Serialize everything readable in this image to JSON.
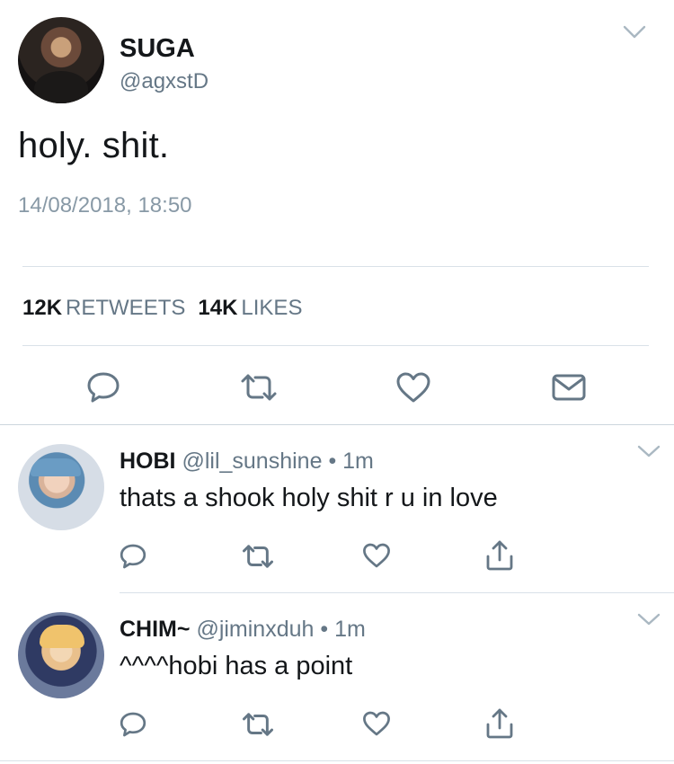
{
  "main_tweet": {
    "name": "SUGA",
    "handle": "@agxstD",
    "text": "holy. shit.",
    "timestamp": "14/08/2018, 18:50",
    "retweets_count": "12K",
    "retweets_label": "RETWEETS",
    "likes_count": "14K",
    "likes_label": "LIKES"
  },
  "replies": [
    {
      "name": "HOBI",
      "handle": "@lil_sunshine",
      "separator": "•",
      "time": "1m",
      "text": "thats a shook holy shit r u in love"
    },
    {
      "name": "CHIM~",
      "handle": "@jiminxduh",
      "separator": "•",
      "time": "1m",
      "text": "^^^^hobi has a point"
    }
  ],
  "icons": {
    "reply": "speech-bubble-icon",
    "retweet": "retweet-icon",
    "like": "heart-icon",
    "message": "envelope-icon",
    "share": "share-icon",
    "more": "chevron-down-icon"
  },
  "colors": {
    "text": "#14171a",
    "secondary": "#657786",
    "timestamp": "#8899a6",
    "divider": "#d9e1e8"
  }
}
